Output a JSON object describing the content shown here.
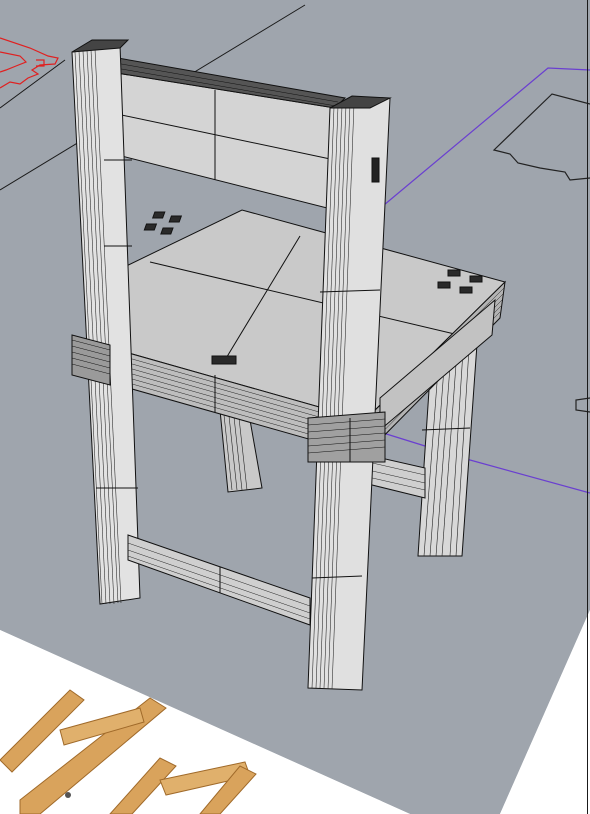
{
  "viewport": {
    "background_color": "#9fa5ad",
    "paper_color": "#ffffff",
    "model_face_color": "#c9c9c9",
    "model_light_face_color": "#d8d8d8",
    "model_edge_color": "#111111",
    "curve_color_red": "#e02020",
    "curve_color_blue": "#6a3fd0",
    "curve_color_black": "#222222",
    "photo_wood_color": "#d9a35c"
  },
  "objects": {
    "model": "chair-mesh",
    "reference_image": "wood-chair-photo",
    "left_curve": "red-outline-curve",
    "right_curve": "black-outline-curve",
    "guide_line": "purple-guide-line"
  }
}
